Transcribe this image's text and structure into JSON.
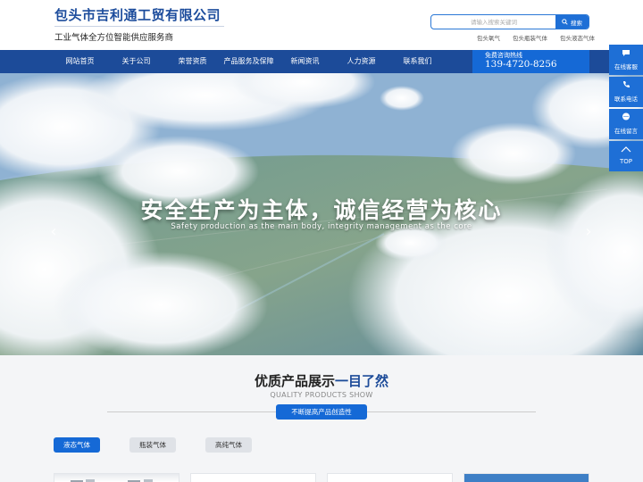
{
  "header": {
    "company_name": "包头市吉利通工贸有限公司",
    "tagline": "工业气体全方位智能供应服务商"
  },
  "search": {
    "placeholder": "请输入搜索关键词",
    "button_label": "搜索",
    "hot_links": [
      "包头氧气",
      "包头瓶装气体",
      "包头液态气体"
    ]
  },
  "nav": {
    "items": [
      "网站首页",
      "关于公司",
      "荣誉资质",
      "产品服务及保障",
      "新闻资讯",
      "人力资源",
      "联系我们"
    ]
  },
  "hotline": {
    "label": "免费咨询热线",
    "number": "139-4720-8256"
  },
  "banner": {
    "title": "安全生产为主体，诚信经营为核心",
    "subtitle": "Safety production as the main body, integrity management as the core"
  },
  "float_bar": {
    "items": [
      {
        "label": "在线客服",
        "icon": "chat-icon"
      },
      {
        "label": "联系电话",
        "icon": "phone-icon"
      },
      {
        "label": "在线留言",
        "icon": "message-icon"
      },
      {
        "label": "TOP",
        "icon": "arrow-up-icon"
      }
    ]
  },
  "products": {
    "title_main": "优质产品展示",
    "title_accent": "一目了然",
    "title_en": "QUALITY PRODUCTS SHOW",
    "badge": "不断提高产品创造性",
    "tabs": [
      "液态气体",
      "瓶装气体",
      "高纯气体"
    ],
    "active_tab": 0
  },
  "colors": {
    "primary": "#1c4b99",
    "accent": "#1569d6",
    "tab_inactive": "#dfe2e7"
  }
}
